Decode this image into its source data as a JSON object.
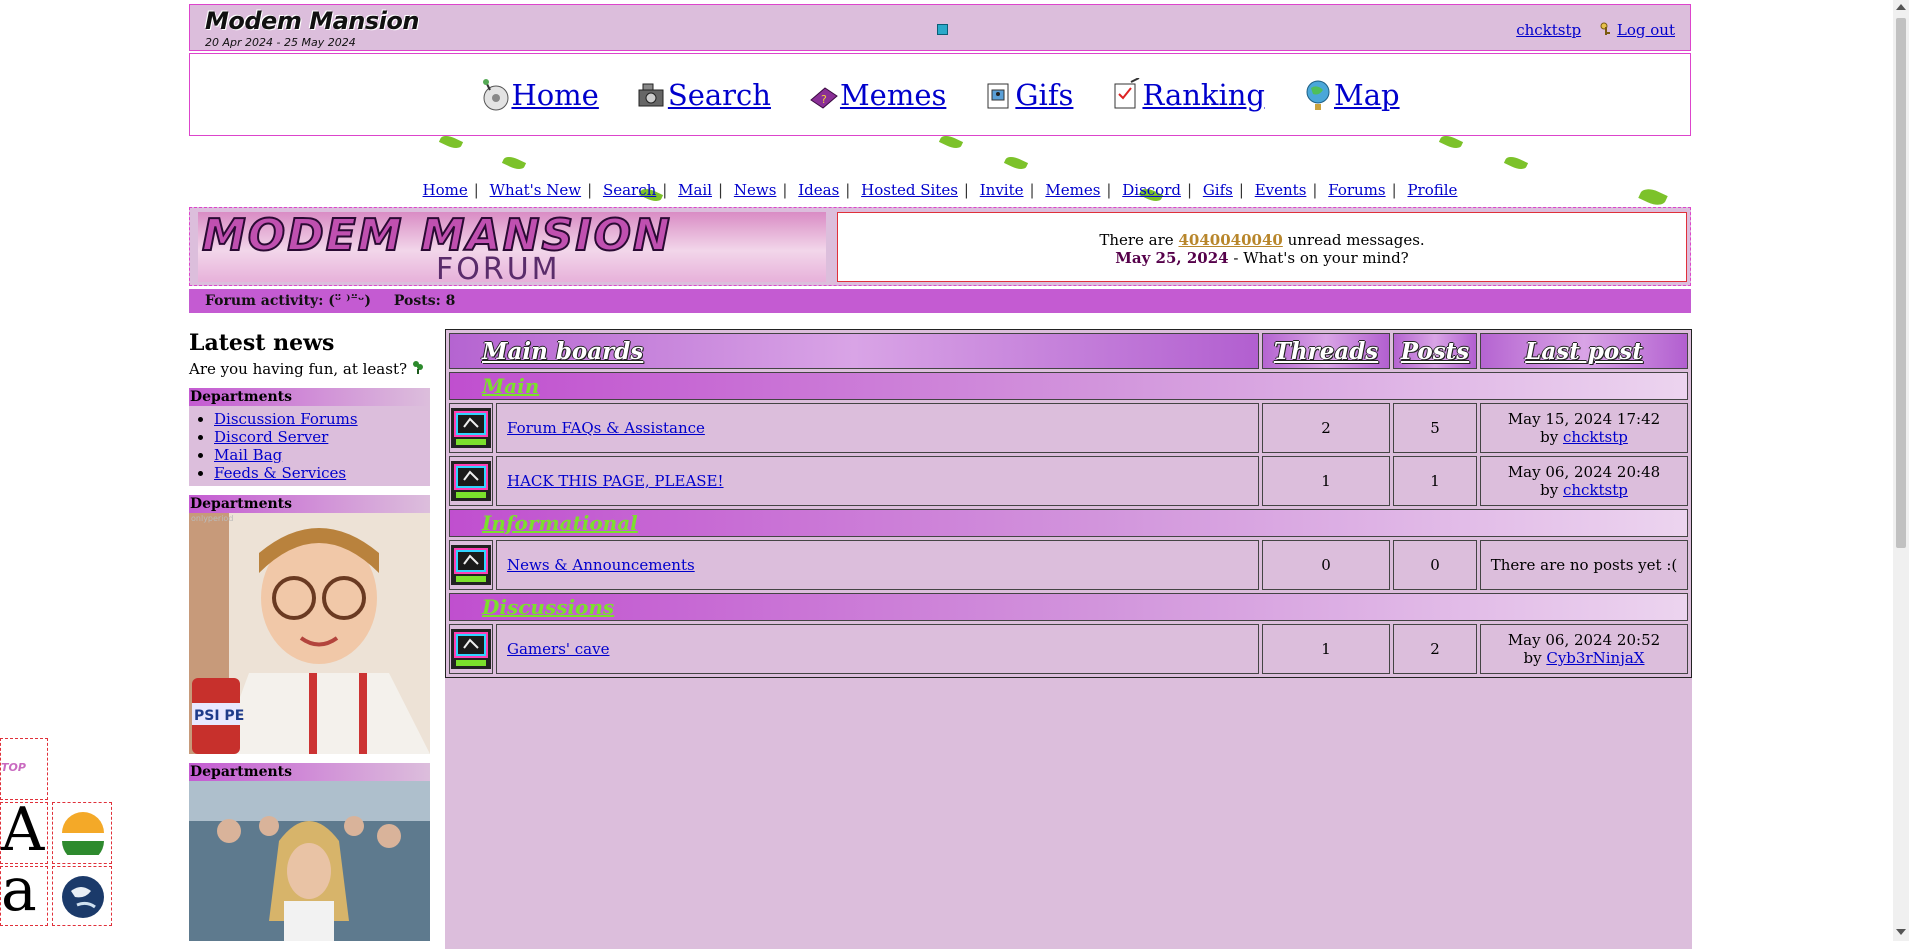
{
  "header": {
    "title": "Modem Mansion",
    "dates": "20 Apr 2024 - 25 May 2024",
    "username": "chcktstp",
    "logout": "Log out"
  },
  "main_nav": [
    {
      "label": "Home",
      "icon": "cd-icon"
    },
    {
      "label": "Search",
      "icon": "camera-icon"
    },
    {
      "label": "Memes",
      "icon": "question-book-icon"
    },
    {
      "label": "Gifs",
      "icon": "picture-frame-icon"
    },
    {
      "label": "Ranking",
      "icon": "checklist-icon"
    },
    {
      "label": "Map",
      "icon": "globe-icon"
    }
  ],
  "sub_nav": [
    "Home",
    "What's New",
    "Search",
    "Mail",
    "News",
    "Ideas",
    "Hosted Sites",
    "Invite",
    "Memes",
    "Discord",
    "Gifs",
    "Events",
    "Forums",
    "Profile"
  ],
  "banner": {
    "logo_top": "MODEM MANSION",
    "logo_bottom": "FORUM",
    "msg_prefix": "There are",
    "unread_count": "4040040040",
    "msg_suffix": "unread messages.",
    "date": "May 25, 2024",
    "prompt": "- What's on your mind?"
  },
  "activity": {
    "label": "Forum activity: (ᵕ̈ ⁾⁻̈ᵕ)",
    "posts": "Posts: 8"
  },
  "sidebar": {
    "news_title": "Latest news",
    "news_sub": "Are you having fun, at least?",
    "dept_title": "Departments",
    "dept_links": [
      "Discussion Forums",
      "Discord Server",
      "Mail Bag",
      "Feeds & Services"
    ],
    "dept2_title": "Departments",
    "dept3_title": "Departments",
    "photo_caption": "onlyperiod",
    "photo_can_text": "PSI  PE"
  },
  "edge": {
    "gif_text": "TOP",
    "glyph_upper": "A",
    "glyph_lower": "a"
  },
  "forum": {
    "headers": {
      "boards": "Main boards",
      "threads": "Threads",
      "posts": "Posts",
      "last": "Last post"
    },
    "categories": [
      {
        "name": "Main",
        "boards": [
          {
            "name": "Forum FAQs & Assistance",
            "threads": "2",
            "posts": "5",
            "last_date": "May 15, 2024 17:42",
            "by": "by",
            "last_user": "chcktstp"
          },
          {
            "name": "HACK THIS PAGE, PLEASE!",
            "threads": "1",
            "posts": "1",
            "last_date": "May 06, 2024 20:48",
            "by": "by",
            "last_user": "chcktstp"
          }
        ]
      },
      {
        "name": "Informational",
        "boards": [
          {
            "name": "News & Announcements",
            "threads": "0",
            "posts": "0",
            "last_date": "There are no posts yet :(",
            "by": "",
            "last_user": ""
          }
        ]
      },
      {
        "name": "Discussions",
        "boards": [
          {
            "name": "Gamers' cave",
            "threads": "1",
            "posts": "2",
            "last_date": "May 06, 2024 20:52",
            "by": "by",
            "last_user": "Cyb3rNinjaX"
          }
        ]
      }
    ]
  },
  "colors": {
    "panel": "#dcbedc",
    "border": "#dd44cc",
    "activity_bar": "#c45bd2",
    "category_text": "#7be02c",
    "unread": "#b8862b"
  }
}
